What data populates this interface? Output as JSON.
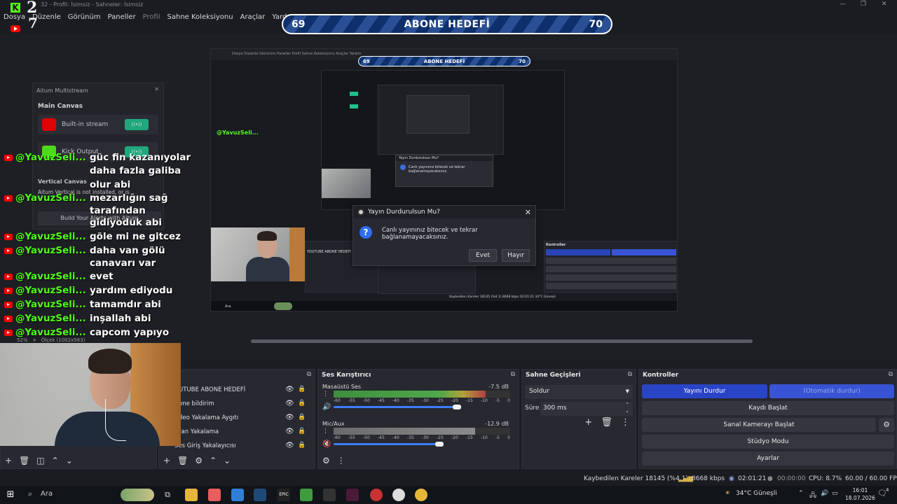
{
  "window": {
    "title": "32 - Profil: İsimsiz - Sahneler: İsimsiz"
  },
  "menu": {
    "items": [
      "Dosya",
      "Düzenle",
      "Görünüm",
      "Paneller",
      "Profil",
      "Sahne Koleksiyonu",
      "Araçlar",
      "Yardım"
    ]
  },
  "goal_banner": {
    "current": "69",
    "title": "ABONE HEDEFİ",
    "target": "70"
  },
  "preview": {
    "zoom": "52%",
    "scale": "Ölçek (1002x563)",
    "inner_menu": "Dosya  Düzenle  Görünüm  Paneller  Profil  Sahne Koleksiyonu  Araçlar  Yardım",
    "mini_dialog_title": "Yayın Durdurulsun Mu?",
    "mini_dialog_body": "Canlı yayınınız bitecek ve tekrar bağlanamayacaksınız.",
    "mini_chat_user": "@YavuzSeli...",
    "mini_taskbar": "Ara",
    "mini_status": "Kaybedilen Kareler 18145 (%4.1)   8668 kbps   02:01:21   34°C Güneşli",
    "mini_controls": "Kontroller",
    "mini_source": "YOUTUBE ABONE HEDEFİ"
  },
  "dialog": {
    "title": "Yayın Durdurulsun Mu?",
    "body": "Canlı yayınınız bitecek ve tekrar bağlanamayacaksınız.",
    "yes": "Evet",
    "no": "Hayır"
  },
  "multistream": {
    "title": "Aitum Multistream",
    "main_canvas": "Main Canvas",
    "builtin": "Built-in stream",
    "kick": "Kick Output",
    "vertical_canvas": "Vertical Canvas",
    "vertical_note": "Aitum Vertical is not installed, or is",
    "build_alerts": "Build Your Alerts with Aitum"
  },
  "chat": {
    "messages": [
      {
        "user": "@YavuzSeli...",
        "lines": [
          "güc fin kazanıyolar",
          "daha fazla galiba",
          "olur abi"
        ]
      },
      {
        "user": "@YavuzSeli...",
        "lines": [
          "mezarlığın sağ",
          "tarafından",
          "gidiyoduk abi"
        ]
      },
      {
        "user": "@YavuzSeli...",
        "lines": [
          "göle mi ne gitcez"
        ]
      },
      {
        "user": "@YavuzSeli...",
        "lines": [
          "daha van gölü",
          "canavarı var"
        ]
      },
      {
        "user": "@YavuzSeli...",
        "lines": [
          "evet"
        ]
      },
      {
        "user": "@YavuzSeli...",
        "lines": [
          "yardım ediyodu"
        ]
      },
      {
        "user": "@YavuzSeli...",
        "lines": [
          "tamamdır abi"
        ]
      },
      {
        "user": "@YavuzSeli...",
        "lines": [
          "inşallah abi"
        ]
      },
      {
        "user": "@YavuzSeli...",
        "lines": [
          "capcom yapıyo"
        ]
      }
    ]
  },
  "sources": {
    "title": "klar",
    "items": [
      "UTUBE ABONE HEDEFİ",
      "one bildirim",
      "deo Yakalama Aygıtı",
      "ran Yakalama",
      "Ses Giriş Yakalayıcısı"
    ]
  },
  "mixer": {
    "title": "Ses Karıştırıcı",
    "channels": [
      {
        "name": "Masaüstü Ses",
        "db": "-7.5 dB",
        "level": 0.86,
        "volume": 0.7
      },
      {
        "name": "Mic/Aux",
        "db": "-12.9 dB",
        "level": 0.8,
        "volume": 0.6
      }
    ],
    "scale": [
      "-60",
      "-55",
      "-50",
      "-45",
      "-40",
      "-35",
      "-30",
      "-25",
      "-20",
      "-15",
      "-10",
      "-5",
      "0"
    ]
  },
  "transitions": {
    "title": "Sahne Geçişleri",
    "selected": "Soldur",
    "duration_label": "Süre",
    "duration": "300 ms"
  },
  "controls": {
    "title": "Kontroller",
    "stop_stream": "Yayını Durdur",
    "auto_stop": "(Otomatik durdur)",
    "start_record": "Kaydı Başlat",
    "virtual_cam": "Sanal Kamerayı Başlat",
    "studio_mode": "Stüdyo Modu",
    "settings": "Ayarlar"
  },
  "status": {
    "dropped": "Kaybedilen Kareler 18145 (%4.1)",
    "bitrate": "8668 kbps",
    "stream_time": "02:01:21",
    "record_time": "00:00:00",
    "cpu": "CPU: 8.7%",
    "fps": "60.00 / 60.00 FPS"
  },
  "taskbar": {
    "search": "Ara",
    "weather": "34°C  Güneşli",
    "time": "16:01",
    "date": "18.07.2026",
    "notifications": "4"
  }
}
